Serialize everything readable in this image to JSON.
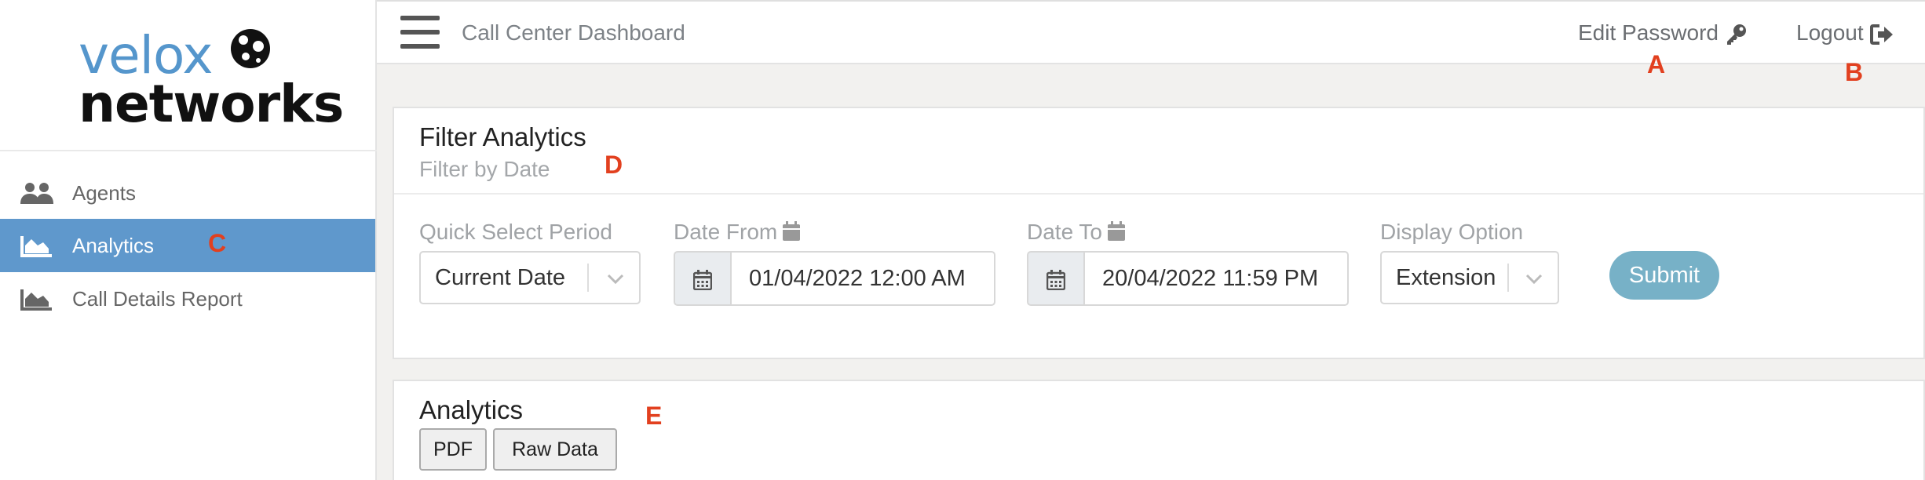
{
  "brand": {
    "logo_line1": "velox",
    "logo_line2": "networks",
    "logo_color": "#5596cc"
  },
  "sidebar": {
    "items": [
      {
        "label": "Agents",
        "icon": "users-icon",
        "active": false
      },
      {
        "label": "Analytics",
        "icon": "area-chart-icon",
        "active": true
      },
      {
        "label": "Call Details Report",
        "icon": "area-chart-icon",
        "active": false
      }
    ],
    "active_color": "#5f98cc"
  },
  "header": {
    "menu_icon": "hamburger-icon",
    "title": "Call Center Dashboard",
    "edit_password": "Edit Password",
    "edit_password_icon": "key-icon",
    "logout": "Logout",
    "logout_icon": "sign-out-icon"
  },
  "markers": {
    "a": "A",
    "b": "B",
    "c": "C",
    "d": "D",
    "e": "E",
    "color": "#e2401f"
  },
  "filter_card": {
    "title": "Filter Analytics",
    "subtitle": "Filter by Date",
    "quick_select": {
      "label": "Quick Select Period",
      "value": "Current Date"
    },
    "date_from": {
      "label": "Date From",
      "value": "01/04/2022 12:00 AM",
      "icon": "calendar-icon"
    },
    "date_to": {
      "label": "Date To",
      "value": "20/04/2022 11:59 PM",
      "icon": "calendar-icon"
    },
    "display_option": {
      "label": "Display Option",
      "value": "Extension"
    },
    "submit_label": "Submit",
    "submit_color": "#77b1c7"
  },
  "analytics_card": {
    "title": "Analytics",
    "pdf_label": "PDF",
    "raw_data_label": "Raw Data"
  }
}
